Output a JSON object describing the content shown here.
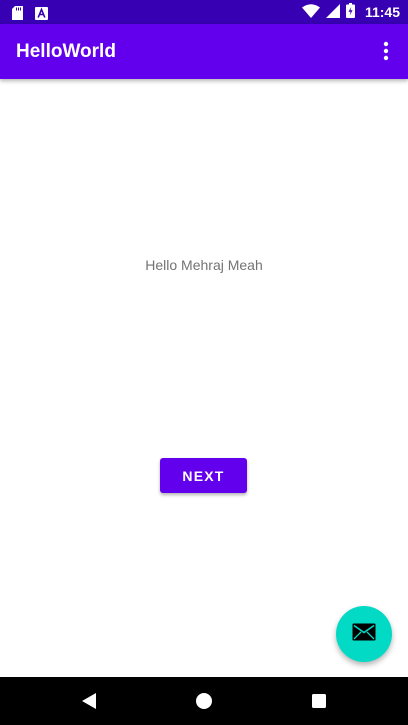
{
  "status_bar": {
    "time": "11:45",
    "left_icons": [
      "sd-card-icon",
      "a-notification-icon"
    ],
    "right_icons": [
      "wifi-icon",
      "cell-signal-icon",
      "battery-icon"
    ],
    "background": "#3700b3"
  },
  "app_bar": {
    "title": "HelloWorld",
    "background": "#6200ee",
    "menu_icon": "more-vert-icon"
  },
  "content": {
    "hello_text": "Hello Mehraj Meah",
    "next_label": "NEXT"
  },
  "fab": {
    "icon": "email-icon",
    "color": "#03dac5"
  },
  "nav_bar": {
    "buttons": [
      "back-icon",
      "home-icon",
      "recents-icon"
    ]
  }
}
